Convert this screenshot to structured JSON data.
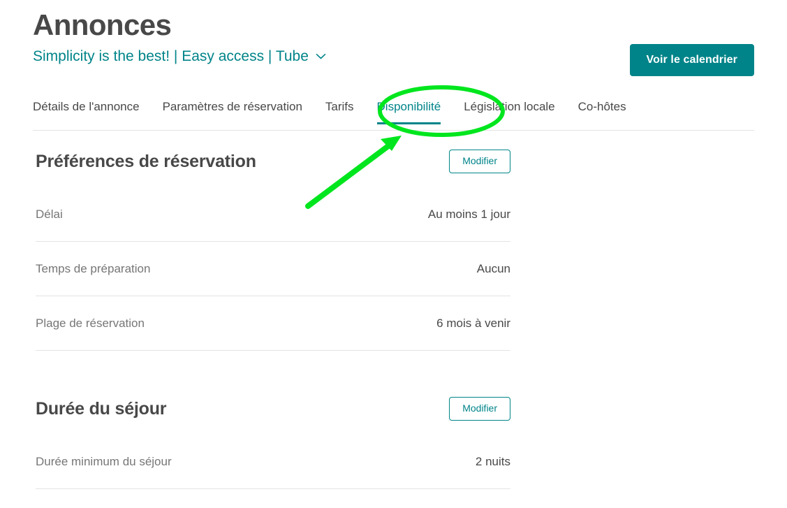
{
  "header": {
    "title": "Annonces",
    "subtitle": "Simplicity is the best! | Easy access | Tube",
    "chevron_icon": "chevron-down-icon",
    "calendar_button": "Voir le calendrier"
  },
  "tabs": [
    {
      "label": "Détails de l'annonce",
      "active": false
    },
    {
      "label": "Paramètres de réservation",
      "active": false
    },
    {
      "label": "Tarifs",
      "active": false
    },
    {
      "label": "Disponibilité",
      "active": true
    },
    {
      "label": "Législation locale",
      "active": false
    },
    {
      "label": "Co-hôtes",
      "active": false
    }
  ],
  "sections": [
    {
      "title": "Préférences de réservation",
      "edit_label": "Modifier",
      "rows": [
        {
          "label": "Délai",
          "value": "Au moins 1 jour"
        },
        {
          "label": "Temps de préparation",
          "value": "Aucun"
        },
        {
          "label": "Plage de réservation",
          "value": "6 mois à venir"
        }
      ]
    },
    {
      "title": "Durée du séjour",
      "edit_label": "Modifier",
      "rows": [
        {
          "label": "Durée minimum du séjour",
          "value": "2 nuits"
        }
      ]
    }
  ],
  "annotation": {
    "ellipse_target": "Disponibilité",
    "arrow": "points-to-disponibilite-tab",
    "color": "#00e61e"
  },
  "colors": {
    "accent": "#008489",
    "title": "#484848",
    "muted": "#767676",
    "divider": "#e4e4e4",
    "annotation": "#00e61e"
  }
}
